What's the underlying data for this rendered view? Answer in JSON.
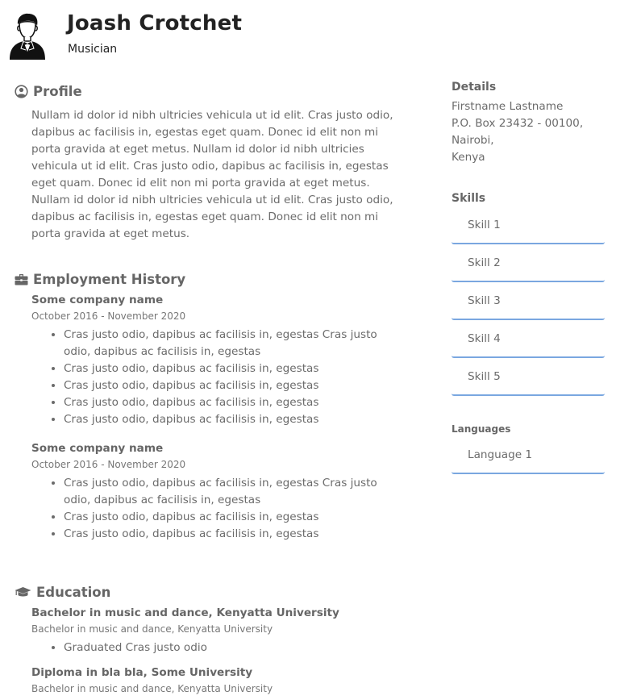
{
  "header": {
    "name": "Joash Crotchet",
    "title": "Musician",
    "avatar_icon": "businessman-avatar-icon"
  },
  "profile": {
    "heading": "Profile",
    "icon": "user-circle-icon",
    "text": "Nullam id dolor id nibh ultricies vehicula ut id elit. Cras justo odio, dapibus ac facilisis in, egestas eget quam. Donec id elit non mi porta gravida at eget metus. Nullam id dolor id nibh ultricies vehicula ut id elit. Cras justo odio, dapibus ac facilisis in, egestas eget quam. Donec id elit non mi porta gravida at eget metus. Nullam id dolor id nibh ultricies vehicula ut id elit. Cras justo odio, dapibus ac facilisis in, egestas eget quam. Donec id elit non mi porta gravida at eget metus."
  },
  "employment": {
    "heading": "Employment History",
    "icon": "briefcase-icon",
    "jobs": [
      {
        "company": "Some company name",
        "dates": "October 2016 - November 2020",
        "bullets": [
          "Cras justo odio, dapibus ac facilisis in, egestas Cras justo odio, dapibus ac facilisis in, egestas",
          "Cras justo odio, dapibus ac facilisis in, egestas",
          "Cras justo odio, dapibus ac facilisis in, egestas",
          "Cras justo odio, dapibus ac facilisis in, egestas",
          "Cras justo odio, dapibus ac facilisis in, egestas"
        ]
      },
      {
        "company": "Some company name",
        "dates": "October 2016 - November 2020",
        "bullets": [
          "Cras justo odio, dapibus ac facilisis in, egestas Cras justo odio, dapibus ac facilisis in, egestas",
          "Cras justo odio, dapibus ac facilisis in, egestas",
          "Cras justo odio, dapibus ac facilisis in, egestas"
        ]
      }
    ]
  },
  "education": {
    "heading": "Education",
    "icon": "graduation-cap-icon",
    "items": [
      {
        "degree": "Bachelor in music and dance, Kenyatta University",
        "subtitle": "Bachelor in music and dance, Kenyatta University",
        "bullets": [
          "Graduated Cras justo odio"
        ]
      },
      {
        "degree": "Diploma in bla bla, Some University",
        "subtitle": "Bachelor in music and dance, Kenyatta University",
        "bullets": []
      }
    ]
  },
  "details": {
    "heading": "Details",
    "lines": [
      "Firstname Lastname",
      "P.O. Box 23432 - 00100,",
      "Nairobi,",
      "Kenya"
    ]
  },
  "skills": {
    "heading": "Skills",
    "items": [
      "Skill 1",
      "Skill 2",
      "Skill 3",
      "Skill 4",
      "Skill 5"
    ]
  },
  "languages": {
    "heading": "Languages",
    "items": [
      "Language 1"
    ]
  },
  "colors": {
    "accent": "#7aa7e0",
    "heading": "#666666",
    "name": "#222222"
  }
}
